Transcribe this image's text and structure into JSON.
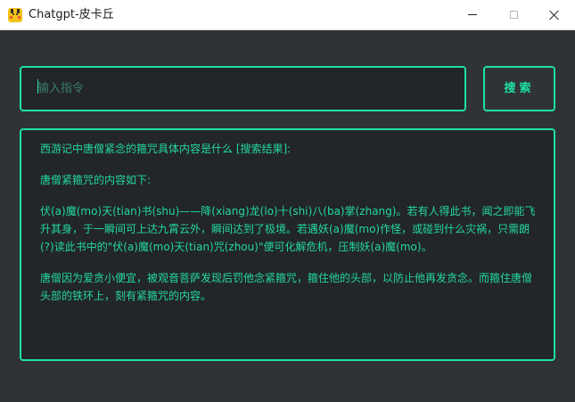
{
  "window": {
    "title": "Chatgpt-皮卡丘",
    "controls": {
      "minimize_icon": "minimize-icon",
      "maximize_icon": "maximize-icon",
      "close_icon": "close-icon"
    }
  },
  "search": {
    "value": "",
    "placeholder": "输入指令",
    "button_label": "搜索"
  },
  "result": {
    "heading": "西游记中唐僧紧念的箍咒具体内容是什么 [搜索结果]:",
    "intro": "唐僧紧箍咒的内容如下:",
    "paragraph1": "伏(a)魔(mo)天(tian)书(shu)——降(xiang)龙(lo)十(shi)八(ba)掌(zhang)。若有人得此书，闻之即能飞升其身，于一瞬间可上达九霄云外，瞬间达到了极境。若遇妖(a)魔(mo)作怪，或碰到什么灾祸，只需朗(?)读此书中的\"伏(a)魔(mo)天(tian)咒(zhou)\"便可化解危机，压制妖(a)魔(mo)。",
    "paragraph2": "唐僧因为爱贪小便宜，被观音菩萨发现后罚他念紧箍咒，箍住他的头部，以防止他再发贪念。而箍住唐僧头部的铁环上，刻有紧箍咒的内容。"
  },
  "colors": {
    "accent": "#1ee0a6",
    "background": "#2f3335",
    "panel": "#222629",
    "text": "#24d7a0"
  }
}
